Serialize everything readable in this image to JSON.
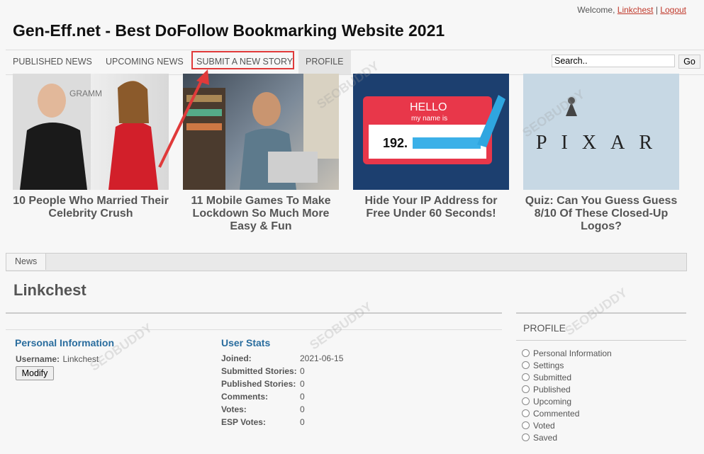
{
  "header": {
    "welcome_text": "Welcome,",
    "user_link": "Linkchest",
    "separator": "|",
    "logout_link": "Logout",
    "site_title": "Gen-Eff.net - Best DoFollow Bookmarking Website 2021"
  },
  "nav": {
    "items": [
      {
        "label": "PUBLISHED NEWS"
      },
      {
        "label": "UPCOMING NEWS"
      },
      {
        "label": "SUBMIT A NEW STORY"
      },
      {
        "label": "PROFILE"
      }
    ],
    "highlight_color": "#e03a3a"
  },
  "search": {
    "value": "Search..",
    "button_label": "Go"
  },
  "stories": [
    {
      "caption": "10 People Who Married Their Celebrity Crush",
      "image_text": "GRAMM"
    },
    {
      "caption": "11 Mobile Games To Make Lockdown So Much More Easy & Fun"
    },
    {
      "caption": "Hide Your IP Address for Free Under 60 Seconds!",
      "image_text": {
        "hello": "HELLO",
        "sub": "my name is",
        "ip": "192."
      }
    },
    {
      "caption": "Quiz: Can You Guess Guess 8/10 Of These Closed-Up Logos?",
      "image_text": "PIXAR"
    }
  ],
  "tabs": {
    "news": "News"
  },
  "profile_page": {
    "username_heading": "Linkchest",
    "personal_info_title": "Personal Information",
    "username_label": "Username:",
    "username_value": "Linkchest",
    "modify_button": "Modify",
    "user_stats_title": "User Stats",
    "stats": [
      {
        "label": "Joined:",
        "value": "2021-06-15"
      },
      {
        "label": "Submitted Stories:",
        "value": "0"
      },
      {
        "label": "Published Stories:",
        "value": "0"
      },
      {
        "label": "Comments:",
        "value": "0"
      },
      {
        "label": "Votes:",
        "value": "0"
      },
      {
        "label": "ESP Votes:",
        "value": "0"
      }
    ]
  },
  "sidebar": {
    "title": "PROFILE",
    "items": [
      {
        "label": "Personal Information"
      },
      {
        "label": "Settings"
      },
      {
        "label": "Submitted"
      },
      {
        "label": "Published"
      },
      {
        "label": "Upcoming"
      },
      {
        "label": "Commented"
      },
      {
        "label": "Voted"
      },
      {
        "label": "Saved"
      }
    ]
  },
  "watermark": "SEOBUDDY"
}
